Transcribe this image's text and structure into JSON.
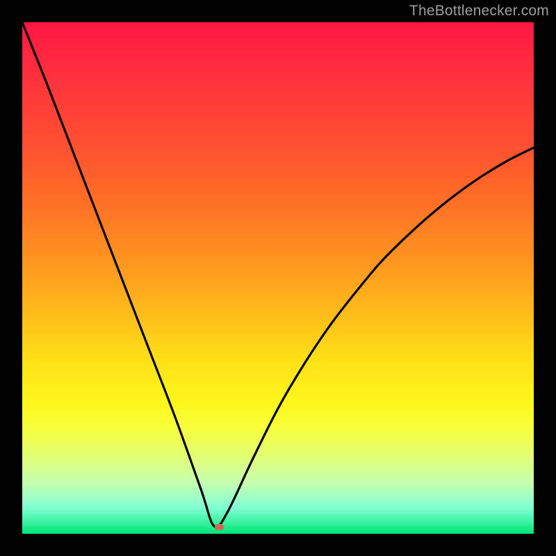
{
  "watermark": "TheBottlenecker.com",
  "chart_data": {
    "type": "line",
    "title": "",
    "xlabel": "",
    "ylabel": "",
    "xlim": [
      0,
      1
    ],
    "ylim": [
      0,
      1
    ],
    "series": [
      {
        "name": "bottleneck-curve",
        "x": [
          0.0,
          0.05,
          0.1,
          0.15,
          0.2,
          0.25,
          0.3,
          0.35,
          0.375,
          0.4,
          0.45,
          0.5,
          0.55,
          0.6,
          0.65,
          0.7,
          0.75,
          0.8,
          0.85,
          0.9,
          0.95,
          1.0
        ],
        "y": [
          1.0,
          0.875,
          0.745,
          0.615,
          0.485,
          0.355,
          0.225,
          0.085,
          0.015,
          0.04,
          0.145,
          0.245,
          0.33,
          0.405,
          0.47,
          0.53,
          0.58,
          0.625,
          0.665,
          0.7,
          0.73,
          0.755
        ]
      }
    ],
    "marker": {
      "x": 0.385,
      "y": 0.014,
      "color": "#c96a5a"
    },
    "background_gradient": {
      "top": "#ff1744",
      "mid_upper": "#ff9a1e",
      "mid_lower": "#ffe018",
      "bottom": "#00e676"
    },
    "frame_color": "#000000"
  }
}
